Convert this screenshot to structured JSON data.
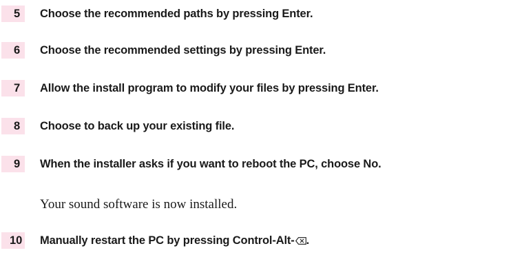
{
  "steps": [
    {
      "number": "5",
      "text": "Choose the recommended paths by pressing Enter."
    },
    {
      "number": "6",
      "text": "Choose the recommended settings by pressing Enter."
    },
    {
      "number": "7",
      "text": "Allow the install program to modify your files by pressing Enter."
    },
    {
      "number": "8",
      "text": "Choose to back up your existing file."
    },
    {
      "number": "9",
      "text": "When the installer asks if you want to reboot the PC, choose No."
    },
    {
      "number": "10",
      "text": "Manually restart the PC by pressing Control-Alt-",
      "suffix": ".",
      "key_icon": "delete-key-icon"
    }
  ],
  "note": "Your sound software is now installed.",
  "colors": {
    "number_highlight": "#fbe1ea",
    "text": "#1a1a1a"
  }
}
